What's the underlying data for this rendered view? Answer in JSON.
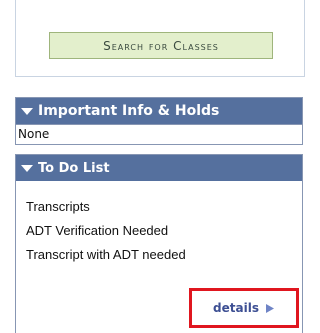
{
  "search": {
    "button_label": "Search for Classes"
  },
  "info_panel": {
    "title": "Important Info & Holds",
    "content": "None"
  },
  "todo_panel": {
    "title": "To Do List",
    "items": [
      "Transcripts",
      "ADT Verification Needed",
      "Transcript with ADT needed"
    ],
    "details_label": "details"
  },
  "colors": {
    "header_bg": "#55709e",
    "button_bg": "#e3efcc",
    "highlight_border": "#e0161f",
    "link": "#3d4f93"
  },
  "icons": {
    "collapse": "collapse-triangle-icon",
    "details": "arrow-right-icon"
  }
}
